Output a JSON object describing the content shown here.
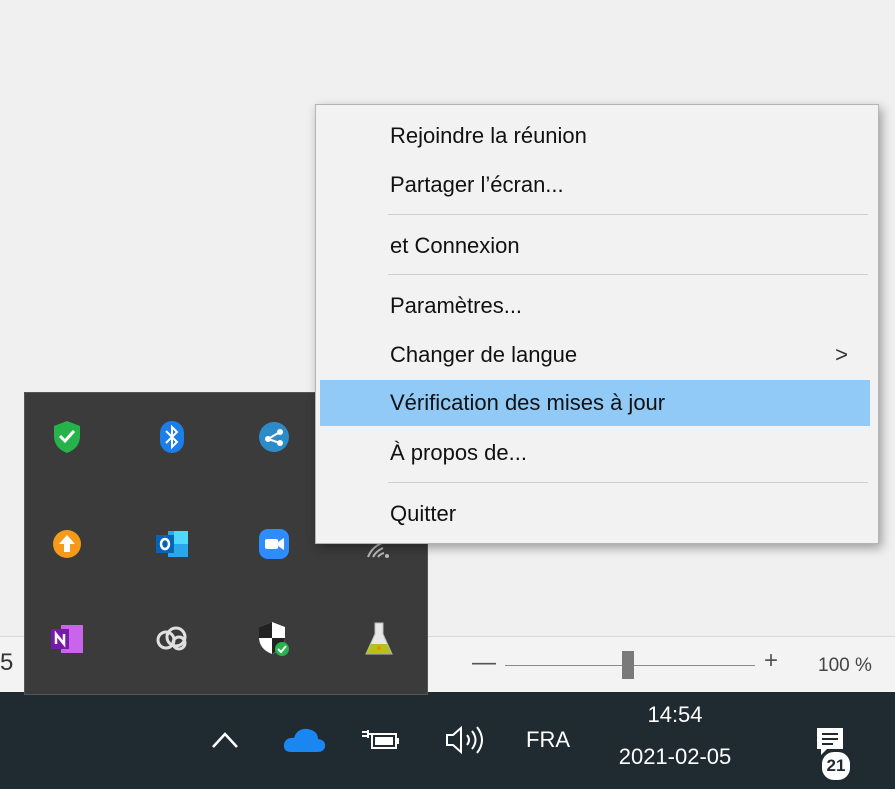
{
  "menu": {
    "items": [
      {
        "label": "Rejoindre la réunion"
      },
      {
        "label": "Partager l’écran..."
      },
      {
        "label": "et Connexion"
      },
      {
        "label": "Paramètres..."
      },
      {
        "label": "Changer de langue",
        "submenu_arrow": ">"
      },
      {
        "label": "Vérification des mises à jour",
        "highlighted": true
      },
      {
        "label": "À propos de..."
      },
      {
        "label": "Quitter"
      }
    ]
  },
  "statusbar": {
    "left_digit": "5",
    "zoom_minus": "—",
    "zoom_plus": "+",
    "zoom_level": "100 %"
  },
  "taskbar": {
    "language": "FRA",
    "time": "14:54",
    "date": "2021-02-05",
    "notification_count": "21"
  },
  "tray": {
    "icons": [
      "defender-check-icon",
      "bluetooth-icon",
      "share-icon",
      "upload-icon",
      "outlook-icon",
      "zoom-icon",
      "wifi-icon",
      "onenote-icon",
      "creative-cloud-icon",
      "security-shield-icon",
      "flask-icon"
    ]
  },
  "colors": {
    "menu_highlight": "#91c9f7",
    "taskbar_bg": "#1f2b30",
    "tray_bg": "#3b3b3b"
  }
}
